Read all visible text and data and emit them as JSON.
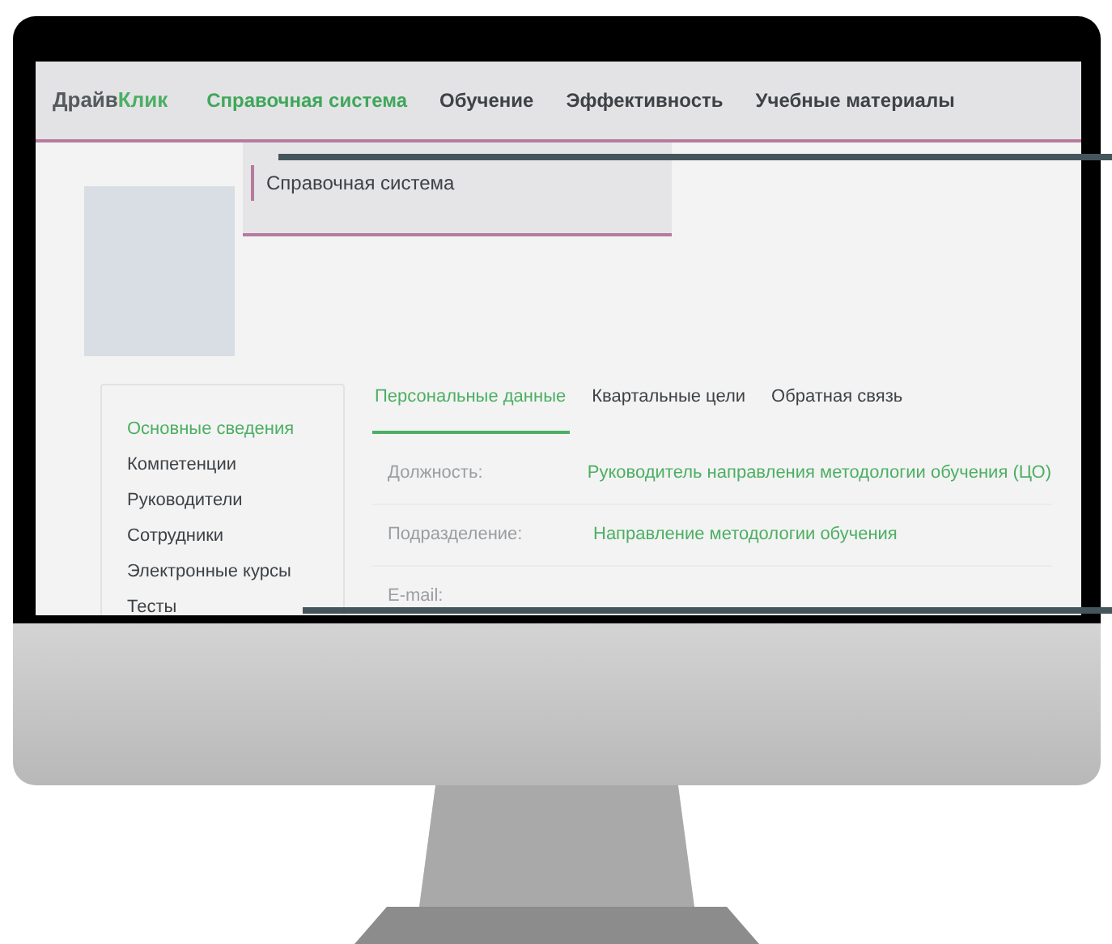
{
  "logo": {
    "part_1": "Драйв",
    "part_2": "Клик"
  },
  "nav": [
    {
      "label": "Справочная система",
      "selected": true
    },
    {
      "label": "Обучение",
      "selected": false
    },
    {
      "label": "Эффективность",
      "selected": false
    },
    {
      "label": "Учебные материалы",
      "selected": false
    }
  ],
  "dropdown": {
    "items": [
      "Справочная система"
    ]
  },
  "sidebar": {
    "items": [
      {
        "label": "Основные сведения",
        "selected": true
      },
      {
        "label": "Компетенции",
        "selected": false
      },
      {
        "label": "Руководители",
        "selected": false
      },
      {
        "label": "Сотрудники",
        "selected": false
      },
      {
        "label": "Электронные курсы",
        "selected": false
      },
      {
        "label": "Тесты",
        "selected": false
      }
    ]
  },
  "tabs": [
    {
      "label": "Персональные данные",
      "selected": true
    },
    {
      "label": "Квартальные цели",
      "selected": false
    },
    {
      "label": "Обратная связь",
      "selected": false
    }
  ],
  "fields": [
    {
      "label": "Должность:",
      "value": "Руководитель направления методологии обучения (ЦО)"
    },
    {
      "label": "Подразделение:",
      "value": "Направление методологии обучения"
    },
    {
      "label": "E-mail:"
    }
  ]
}
